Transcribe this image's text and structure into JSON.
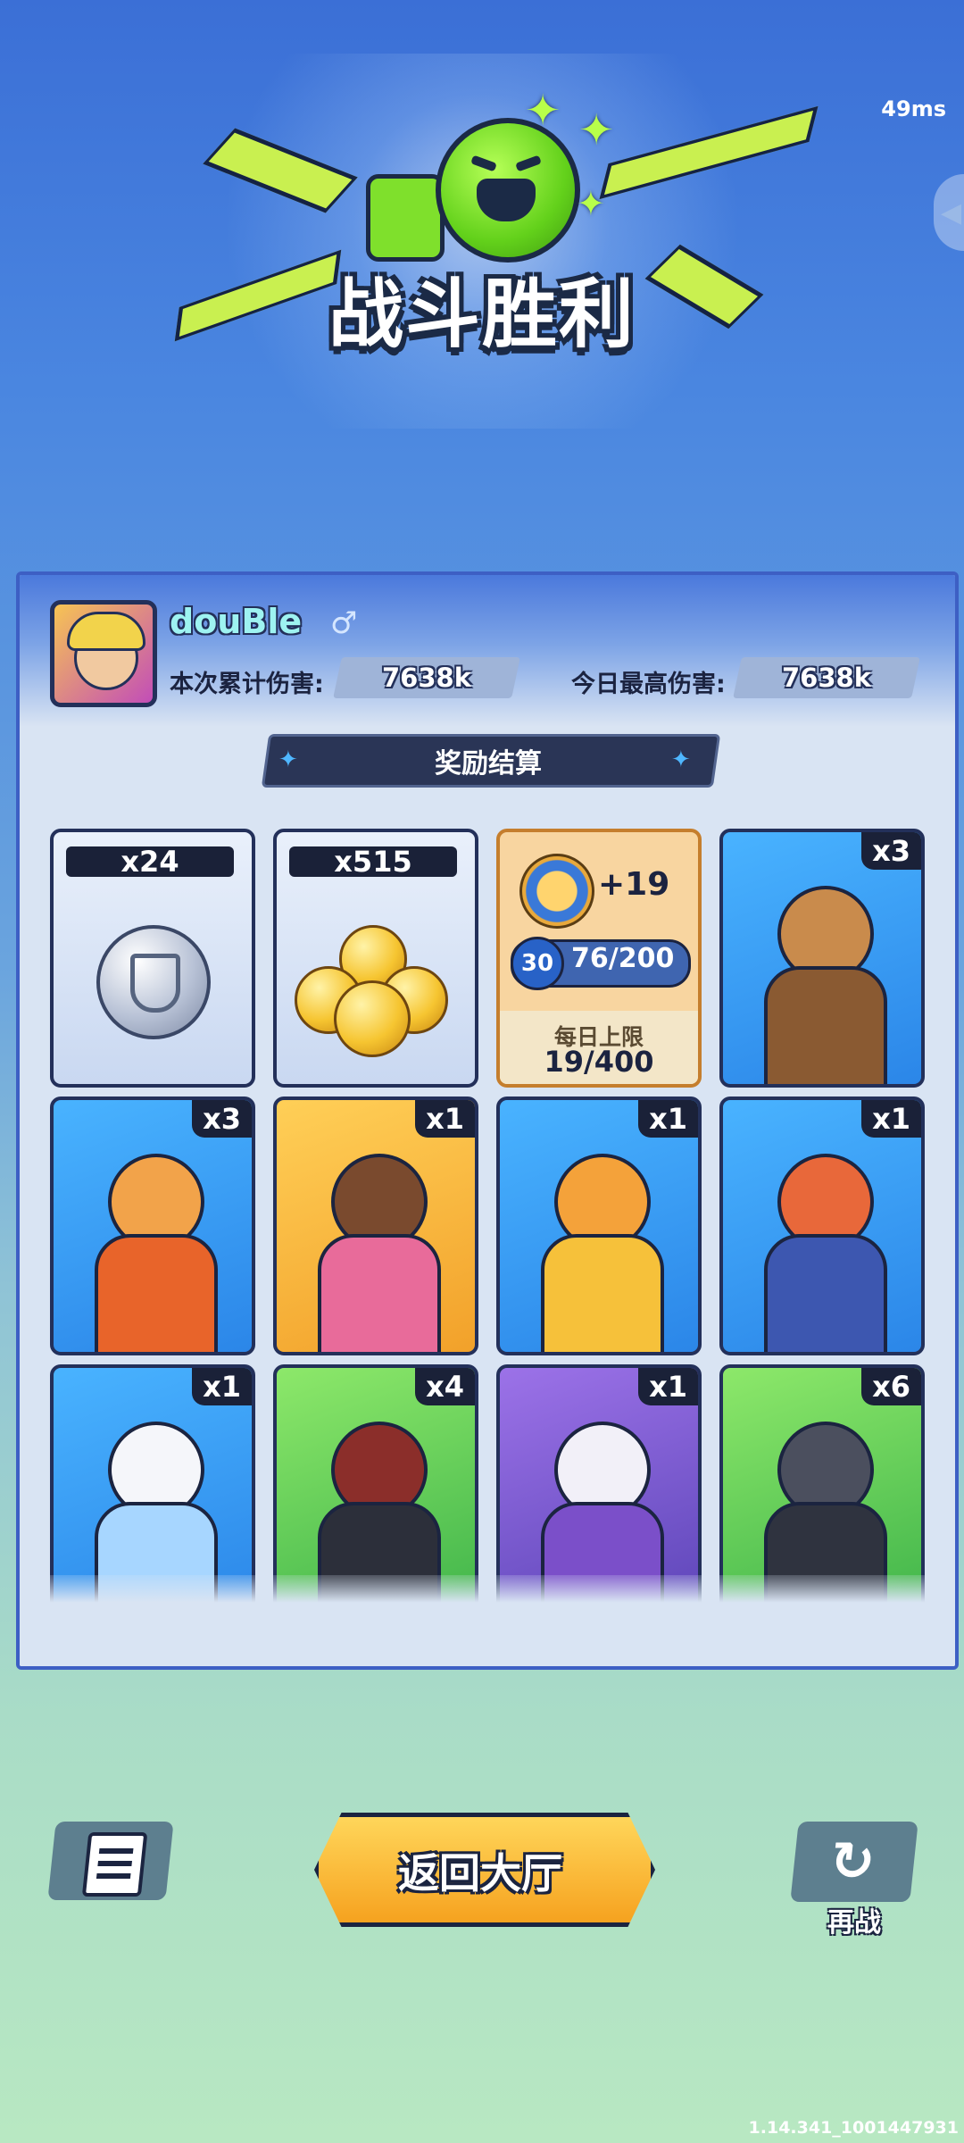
{
  "status": {
    "ping": "49ms"
  },
  "banner": {
    "title": "战斗胜利"
  },
  "player": {
    "name": "douBle",
    "gender_symbol": "♂"
  },
  "stats": {
    "total_damage_label": "本次累计伤害:",
    "total_damage_value": "7638k",
    "daily_best_label": "今日最高伤害:",
    "daily_best_value": "7638k"
  },
  "rewards": {
    "header": "奖励结算",
    "silver_count": "x24",
    "gold_count": "x515",
    "exp": {
      "gain": "+19",
      "level": "30",
      "progress": "76/200",
      "daily_label": "每日上限",
      "daily_value": "19/400"
    },
    "characters": [
      {
        "qty": "x3",
        "theme": "blue",
        "head": "#c98b4c",
        "body": "#8a5a32"
      },
      {
        "qty": "x3",
        "theme": "blue",
        "head": "#f2a34a",
        "body": "#e8642a"
      },
      {
        "qty": "x1",
        "theme": "gold",
        "head": "#7a4a2e",
        "body": "#e86b9a"
      },
      {
        "qty": "x1",
        "theme": "blue",
        "head": "#f4a23a",
        "body": "#f6c13a"
      },
      {
        "qty": "x1",
        "theme": "blue",
        "head": "#e8683a",
        "body": "#3d57b0"
      },
      {
        "qty": "x1",
        "theme": "blue",
        "head": "#f5f6fa",
        "body": "#a7d6ff"
      },
      {
        "qty": "x4",
        "theme": "green",
        "head": "#8b2e2a",
        "body": "#2c2f3a"
      },
      {
        "qty": "x1",
        "theme": "purple",
        "head": "#f2f0f8",
        "body": "#7b4fc9"
      },
      {
        "qty": "x6",
        "theme": "green",
        "head": "#4b4f5e",
        "body": "#2f333f"
      }
    ]
  },
  "buttons": {
    "home": "返回大厅",
    "retry": "再战"
  },
  "footer": {
    "version": "1.14.341_1001447931"
  },
  "colors": {
    "panel_border": "#3d5fc4",
    "button_orange": "#f6a21f",
    "accent_green": "#63d11b"
  }
}
